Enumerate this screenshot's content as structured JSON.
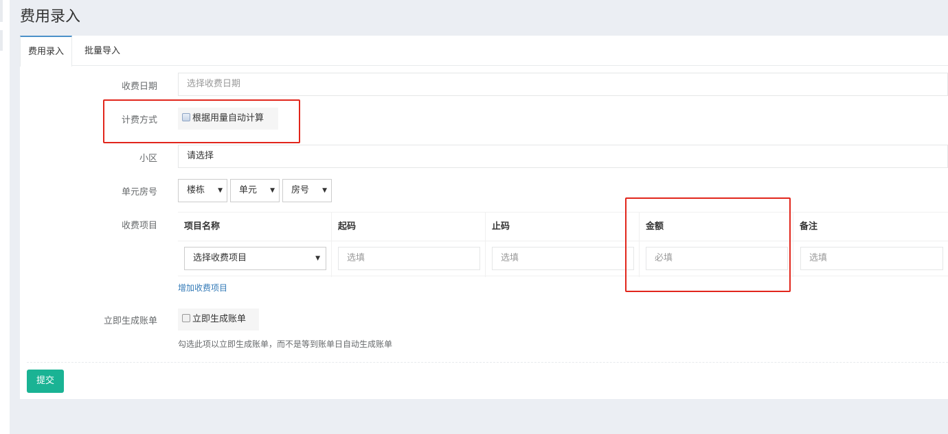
{
  "page": {
    "title": "费用录入"
  },
  "tabs": [
    {
      "label": "费用录入",
      "active": true
    },
    {
      "label": "批量导入",
      "active": false
    }
  ],
  "form": {
    "date": {
      "label": "收费日期",
      "placeholder": "选择收费日期"
    },
    "method": {
      "label": "计费方式",
      "checkbox_label": "根据用量自动计算",
      "checked": false
    },
    "community": {
      "label": "小区",
      "value": "请选择"
    },
    "room": {
      "label": "单元房号",
      "building": "楼栋",
      "unit": "单元",
      "room_no": "房号"
    },
    "fees": {
      "label": "收费项目",
      "columns": [
        "项目名称",
        "起码",
        "止码",
        "金额",
        "备注"
      ],
      "row": {
        "item_select": "选择收费项目",
        "start_placeholder": "选填",
        "end_placeholder": "选填",
        "amount_placeholder": "必填",
        "remark_placeholder": "选填"
      },
      "add_link": "增加收费项目"
    },
    "instant": {
      "label": "立即生成账单",
      "checkbox_label": "立即生成账单",
      "checked": false,
      "help": "勾选此项以立即生成账单，而不是等到账单日自动生成账单"
    },
    "submit_label": "提交"
  },
  "colors": {
    "accent": "#1ab394",
    "link": "#337ab7",
    "tab_active_border": "#4a90c8",
    "annotation": "#e1251b",
    "background": "#ebeef3"
  }
}
